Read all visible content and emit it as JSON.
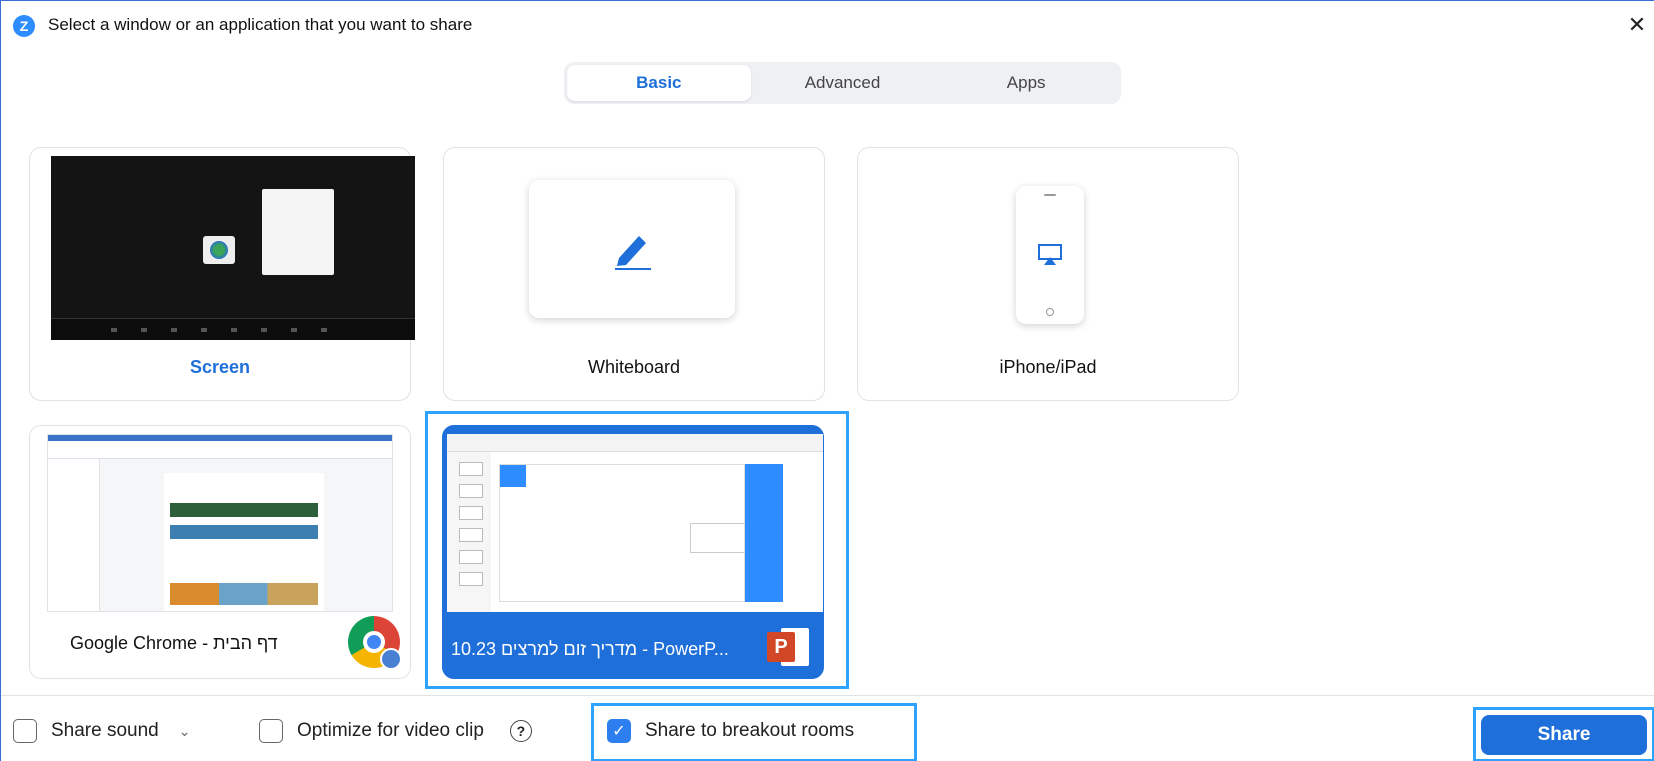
{
  "window": {
    "title": "Select a window or an application that you want to share",
    "logo_letter": "Z",
    "close_glyph": "✕"
  },
  "tabs": [
    {
      "label": "Basic",
      "active": true
    },
    {
      "label": "Advanced",
      "active": false
    },
    {
      "label": "Apps",
      "active": false
    }
  ],
  "cards": {
    "screen": {
      "label": "Screen"
    },
    "whiteboard": {
      "label": "Whiteboard"
    },
    "iphone": {
      "label": "iPhone/iPad"
    },
    "chrome": {
      "label": "Google Chrome - דף הבית"
    },
    "powerpoint": {
      "label": "10.23 מדריך זום למרצים - PowerP...",
      "icon_letter": "P",
      "selected": true
    }
  },
  "footer": {
    "share_sound": {
      "label": "Share sound",
      "checked": false
    },
    "optimize_video": {
      "label": "Optimize for video clip",
      "checked": false
    },
    "info_glyph": "?",
    "breakout": {
      "label": "Share to breakout rooms",
      "checked": true
    },
    "share_button": "Share"
  },
  "colors": {
    "accent": "#1e6fd9",
    "highlight": "#2da2ff",
    "zoom_blue": "#2d8cff",
    "ppt_red": "#d24726"
  },
  "icons": {
    "logo": "zoom-logo-icon",
    "close": "close-icon",
    "whiteboard": "pen-icon",
    "iphone": "airplay-icon",
    "chrome": "chrome-icon",
    "ppt": "powerpoint-icon",
    "chevron": "chevron-down-icon",
    "info": "info-icon"
  }
}
